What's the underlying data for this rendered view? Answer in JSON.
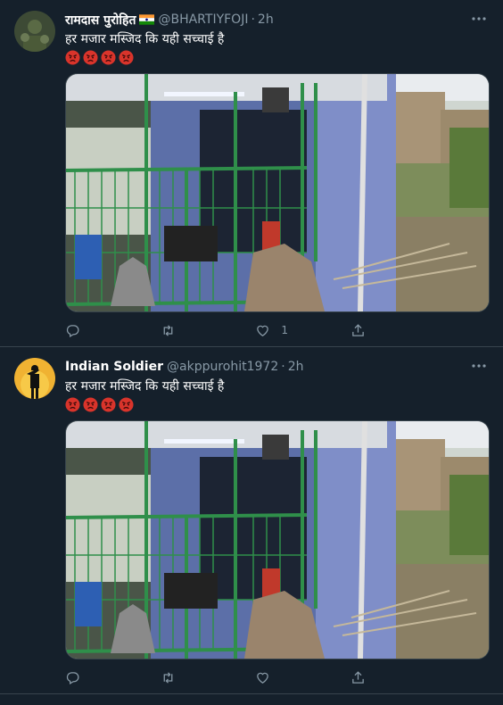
{
  "tweets": [
    {
      "name": "रामदास पुरोहित",
      "handle": "@BHARTIYFOJI",
      "separator": "·",
      "time": "2h",
      "text": "हर मजार मस्जिद कि यही सच्चाई है",
      "emoji": "angry-face",
      "actions": {
        "reply_count": "",
        "retweet_count": "",
        "like_count": "1"
      }
    },
    {
      "name": "Indian Soldier",
      "handle": "@akppurohit1972",
      "separator": "·",
      "time": "2h",
      "text": "हर मजार मस्जिद कि यही सच्चाई है",
      "emoji": "angry-face",
      "actions": {
        "reply_count": "",
        "retweet_count": "",
        "like_count": ""
      }
    }
  ],
  "colors": {
    "background": "#15202b",
    "border": "#38444d",
    "secondary_text": "#8899a6"
  }
}
